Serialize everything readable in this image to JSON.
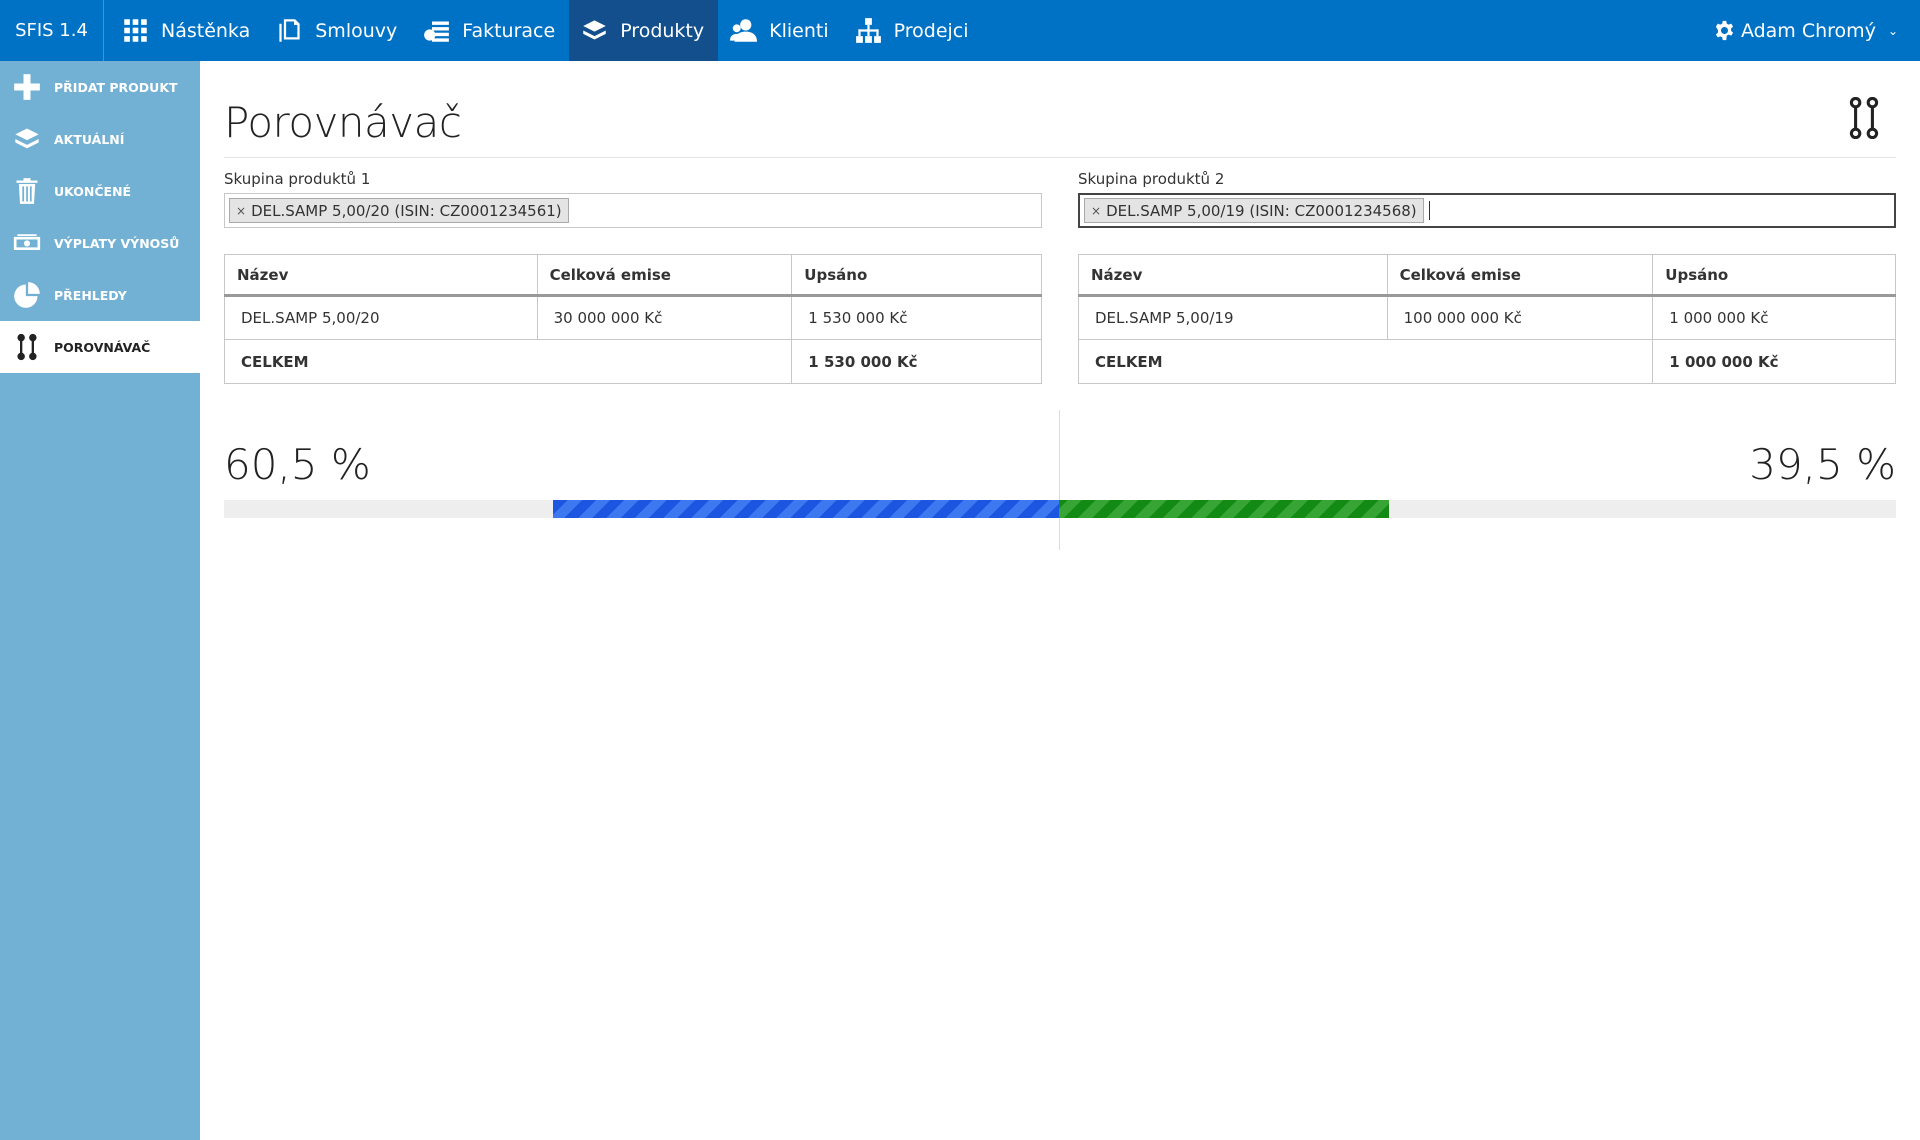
{
  "app": {
    "brand": "SFIS 1.4"
  },
  "nav": [
    {
      "label": "Nástěnka",
      "icon": "grid-icon",
      "active": false
    },
    {
      "label": "Smlouvy",
      "icon": "document-icon",
      "active": false
    },
    {
      "label": "Fakturace",
      "icon": "invoice-icon",
      "active": false
    },
    {
      "label": "Produkty",
      "icon": "layers-icon",
      "active": true
    },
    {
      "label": "Klienti",
      "icon": "users-icon",
      "active": false
    },
    {
      "label": "Prodejci",
      "icon": "hierarchy-icon",
      "active": false
    }
  ],
  "user": {
    "name": "Adam Chromý",
    "icon": "gear-icon"
  },
  "sidebar": [
    {
      "label": "PŘIDAT PRODUKT",
      "icon": "plus-icon",
      "active": false
    },
    {
      "label": "AKTUÁLNÍ",
      "icon": "layers-icon",
      "active": false
    },
    {
      "label": "UKONČENÉ",
      "icon": "trash-icon",
      "active": false
    },
    {
      "label": "VÝPLATY VÝNOSŮ",
      "icon": "money-icon",
      "active": false
    },
    {
      "label": "PŘEHLEDY",
      "icon": "pie-chart-icon",
      "active": false
    },
    {
      "label": "POROVNÁVAČ",
      "icon": "compare-icon",
      "active": true
    }
  ],
  "page": {
    "title": "Porovnávač",
    "title_icon": "compare-icon"
  },
  "groups": [
    {
      "label": "Skupina produktů 1",
      "chip": "DEL.SAMP 5,00/20 (ISIN: CZ0001234561)",
      "chip_remove": "×"
    },
    {
      "label": "Skupina produktů 2",
      "chip": "DEL.SAMP 5,00/19 (ISIN: CZ0001234568)",
      "chip_remove": "×"
    }
  ],
  "tables": [
    {
      "headers": [
        "Název",
        "Celková emise",
        "Upsáno"
      ],
      "row": [
        "DEL.SAMP 5,00/20",
        "30 000 000 Kč",
        "1 530 000 Kč"
      ],
      "total_label": "CELKEM",
      "total_value": "1 530 000 Kč"
    },
    {
      "headers": [
        "Název",
        "Celková emise",
        "Upsáno"
      ],
      "row": [
        "DEL.SAMP 5,00/19",
        "100 000 000 Kč",
        "1 000 000 Kč"
      ],
      "total_label": "CELKEM",
      "total_value": "1 000 000 Kč"
    }
  ],
  "comparison": {
    "left_percent": "60,5 %",
    "right_percent": "39,5 %",
    "left_fraction": 0.605,
    "right_fraction": 0.395,
    "left_color": "#1b55e0",
    "right_color": "#138a13"
  }
}
